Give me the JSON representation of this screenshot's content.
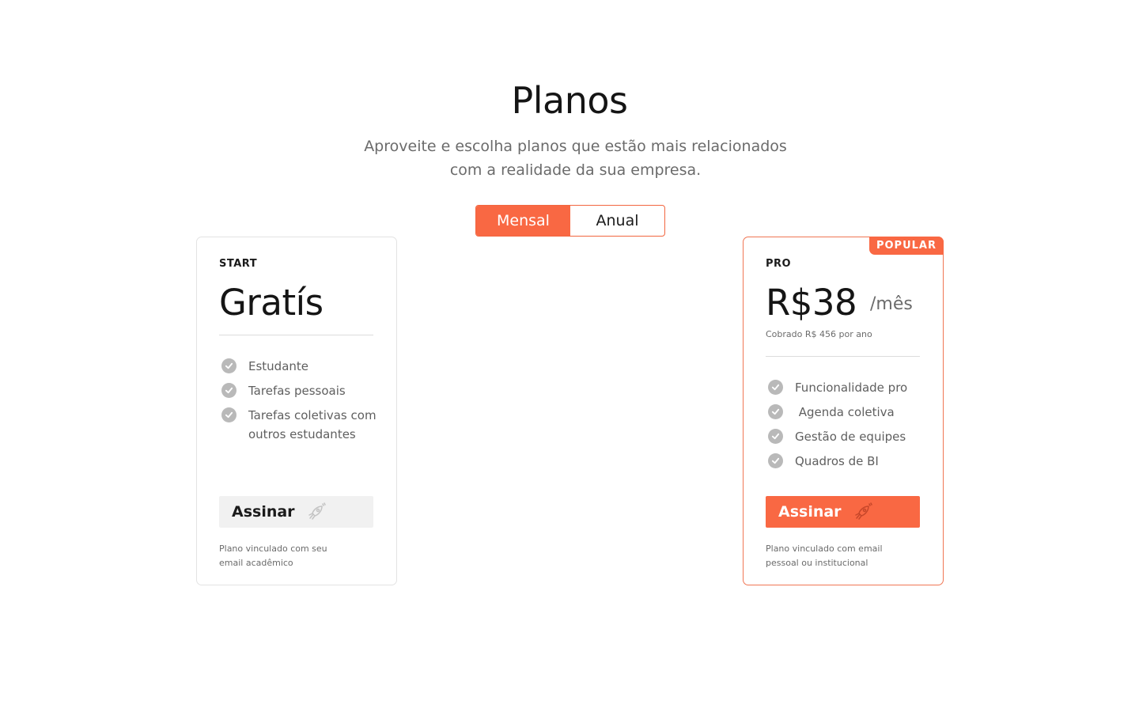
{
  "header": {
    "title": "Planos",
    "subtitle": "Aproveite e escolha planos que estão mais relacionados com a realidade da sua empresa."
  },
  "billing_toggle": {
    "options": [
      "Mensal",
      "Anual"
    ],
    "selected": "Mensal"
  },
  "plans": [
    {
      "name": "START",
      "price": "Gratís",
      "features": [
        "Estudante",
        "Tarefas pessoais",
        "Tarefas coletivas com outros estudantes"
      ],
      "cta_label": "Assinar",
      "note": "Plano vinculado com seu email acadêmico"
    },
    {
      "name": "PRO",
      "badge": "POPULAR",
      "price": "R$38",
      "period": "/mês",
      "billed_note": "Cobrado R$ 456 por ano",
      "features": [
        "Funcionalidade pro",
        " Agenda coletiva",
        "Gestão de equipes",
        "Quadros de BI"
      ],
      "cta_label": "Assinar",
      "note": "Plano vinculado com email pessoal ou institucional"
    }
  ],
  "colors": {
    "accent": "#f96843",
    "accent_border": "#f07654",
    "check_icon": "#b9b9b9",
    "muted_text": "#6b6b6b"
  },
  "icons": {
    "feature": "check-circle-icon",
    "cta": "rocket-icon"
  }
}
